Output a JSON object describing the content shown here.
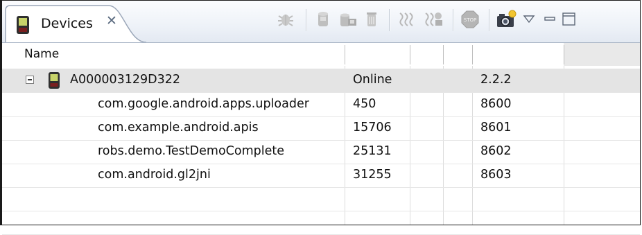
{
  "view": {
    "tab_title": "Devices",
    "close_glyph": "✕"
  },
  "toolbar": {
    "buttons": [
      {
        "name": "debug-process",
        "icon": "bug-icon"
      },
      {
        "name": "update-heap",
        "icon": "heap-cylinder-icon"
      },
      {
        "name": "dump-hprof",
        "icon": "hprof-icon"
      },
      {
        "name": "cause-gc",
        "icon": "trash-icon"
      },
      {
        "name": "update-threads",
        "icon": "threads-icon"
      },
      {
        "name": "start-method-profiling",
        "icon": "method-profiling-icon"
      },
      {
        "name": "stop-process",
        "icon": "stop-icon"
      },
      {
        "name": "screen-capture",
        "icon": "camera-icon"
      }
    ],
    "view_menu_icon": "chevron-down-icon",
    "minimize_icon": "minimize-icon",
    "maximize_icon": "maximize-icon"
  },
  "table": {
    "columns": [
      "Name",
      "",
      "",
      "",
      "",
      ""
    ],
    "device": {
      "name": "A000003129D322",
      "status": "Online",
      "version": "2.2.2"
    },
    "processes": [
      {
        "name": "com.google.android.apps.uploader",
        "pid": "450",
        "port": "8600"
      },
      {
        "name": "com.example.android.apis",
        "pid": "15706",
        "port": "8601"
      },
      {
        "name": "robs.demo.TestDemoComplete",
        "pid": "25131",
        "port": "8602"
      },
      {
        "name": "com.android.gl2jni",
        "pid": "31255",
        "port": "8603"
      }
    ]
  },
  "colors": {
    "selected_row": "#e4e4e4",
    "header_gradient_top": "#fbfcfe",
    "header_gradient_bottom": "#e3e9f2"
  }
}
